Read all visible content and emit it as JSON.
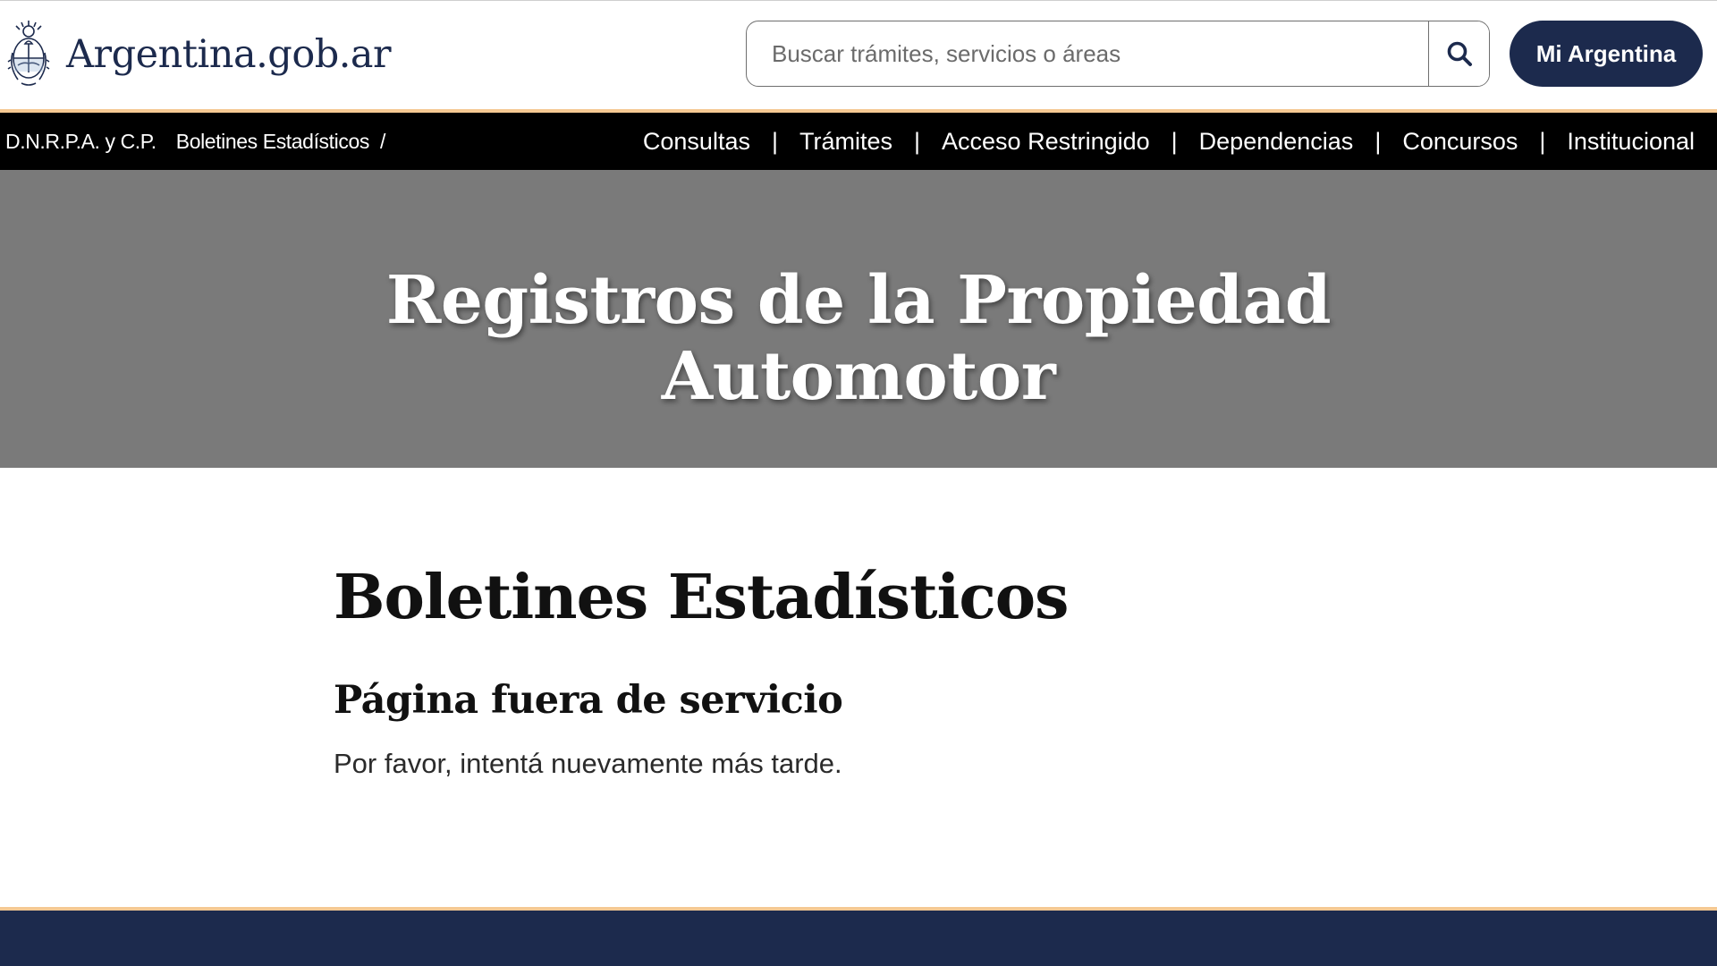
{
  "header": {
    "logo_text": "Argentina.gob.ar",
    "search_placeholder": "Buscar trámites, servicios o áreas",
    "mi_argentina_label": "Mi Argentina"
  },
  "breadcrumb": {
    "items": [
      "D.N.R.P.A. y C.P.",
      "Boletines Estadísticos"
    ],
    "separator": "/"
  },
  "nav": {
    "items": [
      "Consultas",
      "Trámites",
      "Acceso Restringido",
      "Dependencias",
      "Concursos",
      "Institucional"
    ],
    "separator": "|"
  },
  "hero": {
    "line1": "Registros de la Propiedad",
    "line2": "Automotor"
  },
  "content": {
    "title": "Boletines Estadísticos",
    "subtitle": "Página fuera de servicio",
    "message": "Por favor, intentá nuevamente más tarde."
  },
  "colors": {
    "primary": "#1c2a4d",
    "accent": "#f5c993",
    "navbar": "#000000",
    "hero": "#7a7a7a"
  },
  "icons": {
    "logo": "escudo-argentina-icon",
    "search": "search-icon"
  }
}
